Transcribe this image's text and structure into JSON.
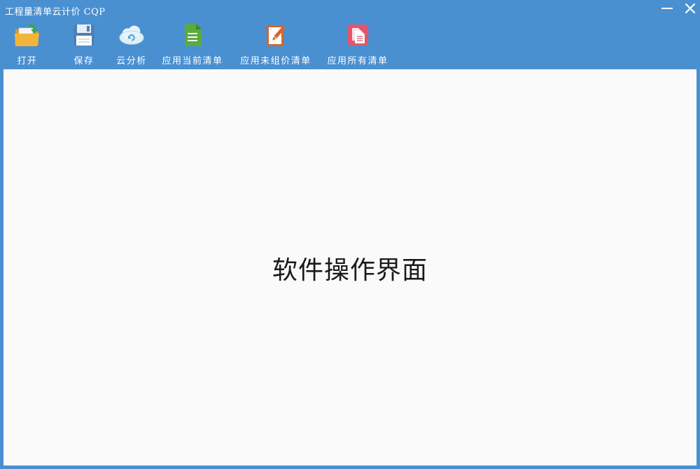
{
  "window": {
    "title": "工程量清单云计价  CQP",
    "minimize_icon": "minimize-icon",
    "close_icon": "close-icon"
  },
  "toolbar": {
    "items": [
      {
        "label": "打开",
        "icon": "open-folder-icon"
      },
      {
        "label": "保存",
        "icon": "floppy-disk-icon"
      },
      {
        "label": "云分析",
        "icon": "cloud-sync-icon"
      },
      {
        "label": "应用当前清单",
        "icon": "green-document-icon"
      },
      {
        "label": "应用未组价清单",
        "icon": "edit-document-icon"
      },
      {
        "label": "应用所有清单",
        "icon": "pink-documents-icon"
      }
    ]
  },
  "main": {
    "placeholder": "软件操作界面"
  },
  "colors": {
    "chrome": "#4a90d1",
    "content_bg": "#fafafa"
  }
}
